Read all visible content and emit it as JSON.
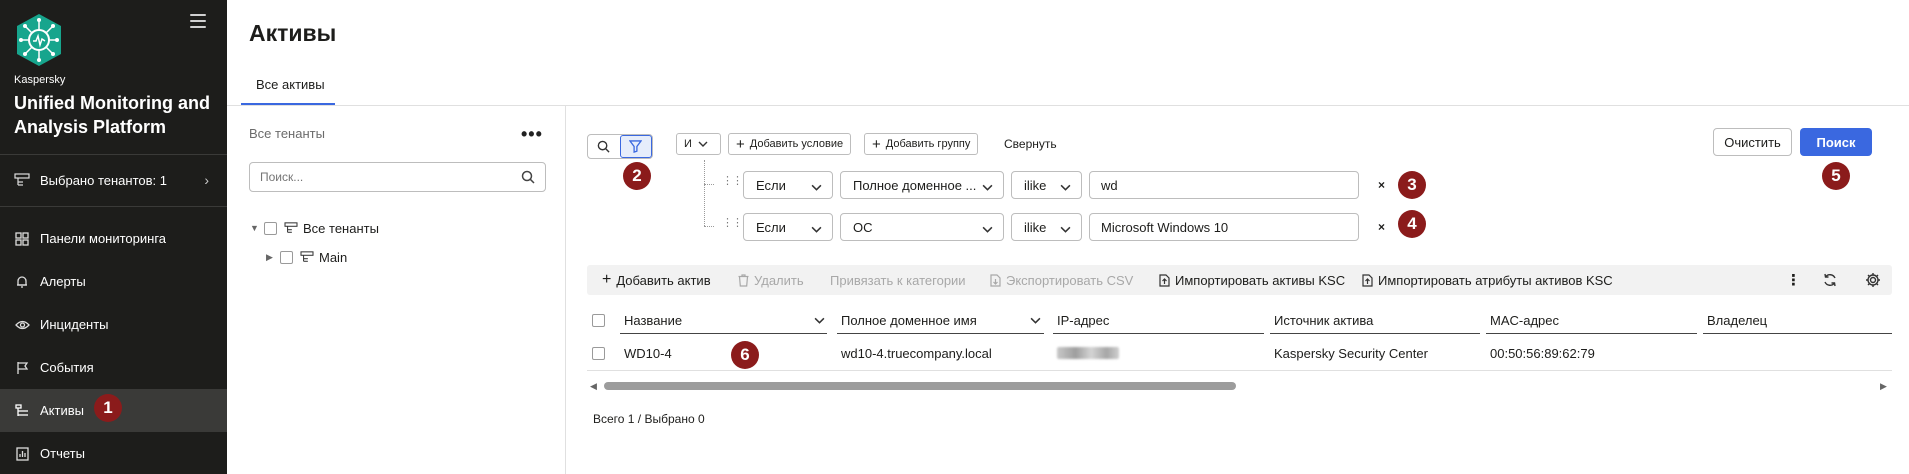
{
  "sidebar": {
    "brand_small": "Kaspersky",
    "brand_title": "Unified Monitoring and Analysis Platform",
    "tenant_selector": "Выбрано тенантов: 1",
    "items": [
      {
        "label": "Панели мониторинга",
        "icon": "dashboard-icon"
      },
      {
        "label": "Алерты",
        "icon": "bell-icon"
      },
      {
        "label": "Инциденты",
        "icon": "eye-icon"
      },
      {
        "label": "События",
        "icon": "flag-icon"
      },
      {
        "label": "Активы",
        "icon": "assets-icon",
        "active": true
      },
      {
        "label": "Отчеты",
        "icon": "report-icon"
      }
    ]
  },
  "header": {
    "title": "Активы",
    "tabs": [
      {
        "label": "Все активы",
        "active": true
      }
    ]
  },
  "tree": {
    "heading": "Все тенанты",
    "search_placeholder": "Поиск...",
    "nodes": [
      {
        "label": "Все тенанты",
        "expanded": true
      },
      {
        "label": "Main",
        "expanded": false
      }
    ]
  },
  "filter": {
    "operator": "И",
    "add_condition": "Добавить условие",
    "add_group": "Добавить группу",
    "collapse": "Свернуть",
    "conditions": [
      {
        "prefix": "Если",
        "field": "Полное доменное ...",
        "op": "ilike",
        "value": "wd"
      },
      {
        "prefix": "Если",
        "field": "ОС",
        "op": "ilike",
        "value": "Microsoft Windows 10"
      }
    ],
    "remove_symbol": "×",
    "clear": "Очистить",
    "search": "Поиск"
  },
  "toolbar": {
    "add_asset": "Добавить актив",
    "delete": "Удалить",
    "link_category": "Привязать к категории",
    "export_csv": "Экспортировать CSV",
    "import_ksc": "Импортировать активы KSC",
    "import_attrs": "Импортировать атрибуты активов KSC"
  },
  "table": {
    "columns": [
      "Название",
      "Полное доменное имя",
      "IP-адрес",
      "Источник актива",
      "MAC-адрес",
      "Владелец"
    ],
    "rows": [
      {
        "name": "WD10-4",
        "fqdn": "wd10-4.truecompany.local",
        "ip": "",
        "source": "Kaspersky Security Center",
        "mac": "00:50:56:89:62:79",
        "owner": ""
      }
    ],
    "footer": "Всего 1 / Выбрано 0"
  },
  "badges": [
    "1",
    "2",
    "3",
    "4",
    "5",
    "6"
  ],
  "colors": {
    "accent": "#3a68e0",
    "sidebar_bg": "#1d1d1b",
    "badge": "#8b1b1b",
    "logo": "#17a58d"
  }
}
